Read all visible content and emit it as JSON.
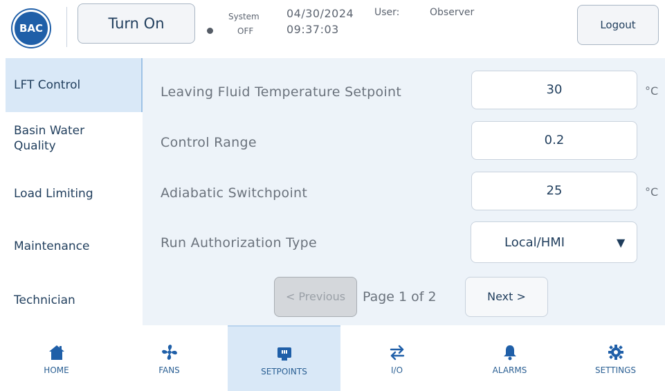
{
  "header": {
    "logo_text": "BAC",
    "turn_on_label": "Turn On",
    "system_label": "System",
    "system_value": "OFF",
    "date": "04/30/2024",
    "time": "09:37:03",
    "user_label": "User:",
    "user_value": "Observer",
    "logout_label": "Logout"
  },
  "sidebar": {
    "items": [
      {
        "label": "LFT Control",
        "active": true
      },
      {
        "label": "Basin Water Quality",
        "active": false
      },
      {
        "label": "Load Limiting",
        "active": false
      },
      {
        "label": "Maintenance",
        "active": false
      },
      {
        "label": "Technician",
        "active": false
      }
    ]
  },
  "setpoints": [
    {
      "label": "Leaving Fluid Temperature Setpoint",
      "value": "30",
      "unit": "°C"
    },
    {
      "label": "Control Range",
      "value": "0.2",
      "unit": ""
    },
    {
      "label": "Adiabatic Switchpoint",
      "value": "25",
      "unit": "°C"
    },
    {
      "label": "Run Authorization Type",
      "value": "Local/HMI",
      "unit": "",
      "type": "select"
    }
  ],
  "pagination": {
    "previous_label": "< Previous",
    "page_label": "Page 1 of 2",
    "next_label": "Next >"
  },
  "nav": {
    "items": [
      {
        "label": "HOME",
        "icon": "home-icon"
      },
      {
        "label": "FANS",
        "icon": "fan-icon"
      },
      {
        "label": "SETPOINTS",
        "icon": "setpoints-icon",
        "active": true
      },
      {
        "label": "I/O",
        "icon": "io-icon"
      },
      {
        "label": "ALARMS",
        "icon": "bell-icon"
      },
      {
        "label": "SETTINGS",
        "icon": "gear-icon"
      }
    ]
  },
  "colors": {
    "accent": "#1f5fa8",
    "active_bg": "#d9e8f7",
    "content_bg": "#edf3f9",
    "text_dark": "#1f3d5c"
  }
}
